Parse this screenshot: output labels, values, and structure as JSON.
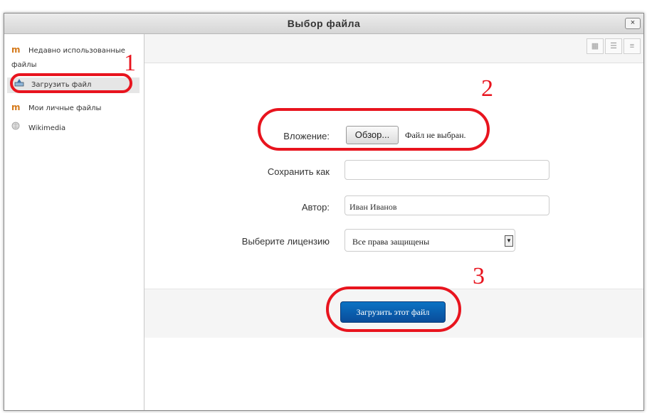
{
  "dialog": {
    "title": "Выбор файла",
    "close_label": "×"
  },
  "sidebar": {
    "items": [
      {
        "label": "Недавно использованные файлы",
        "icon": "moodle-icon"
      },
      {
        "label": "Загрузить файл",
        "icon": "upload-icon",
        "active": true
      },
      {
        "label": "Мои личные файлы",
        "icon": "moodle-icon"
      },
      {
        "label": "Wikimedia",
        "icon": "globe-icon"
      }
    ]
  },
  "toolbar": {
    "view_icons": [
      "grid-view-icon",
      "list-view-icon",
      "tree-view-icon"
    ]
  },
  "form": {
    "attachment_label": "Вложение:",
    "browse_label": "Обзор...",
    "no_file_text": "Файл не выбран.",
    "save_as_label": "Сохранить как",
    "save_as_value": "",
    "author_label": "Автор:",
    "author_value": "Иван Иванов",
    "license_label": "Выберите лицензию",
    "license_value": "Все права защищены",
    "upload_button": "Загрузить этот файл"
  },
  "annotations": {
    "marks": [
      "1",
      "2",
      "3"
    ],
    "color": "#e8141e"
  },
  "colors": {
    "primary_button": "#0a5aa8",
    "title_bar": "#dedede"
  }
}
